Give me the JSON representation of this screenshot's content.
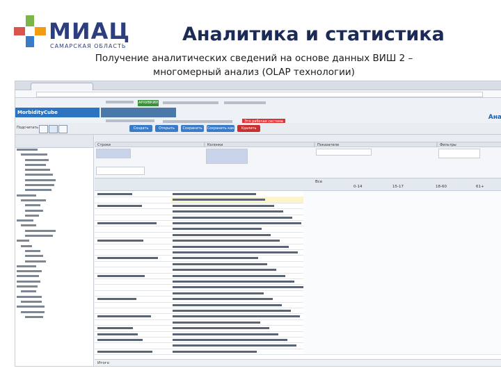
{
  "header": {
    "logo_text": "МИАЦ",
    "logo_subtitle": "САМАРСКАЯ ОБЛАСТЬ",
    "title": "Аналитика и статистика",
    "subtitle_line1": "Получение аналитических сведений на основе данных ВИШ 2 –",
    "subtitle_line2": "многомерный анализ (OLAP технологии)"
  },
  "colors": {
    "logo_blue": "#2c3e7d",
    "cross_green": "#7ab648",
    "cross_orange": "#f39c12",
    "cross_blue": "#3a7bc8",
    "cross_red": "#d9534f"
  },
  "screenshot": {
    "brand": "MorbidityCube",
    "status_green": "АРХИВКИИ",
    "status_red": "Это рабочая система",
    "toolbar_label": "Подсчитать",
    "toolbar_buttons": [
      "Создать",
      "Открыть",
      "Сохранить",
      "Сохранить как",
      "Удалить"
    ],
    "toolbar_right": "Ана",
    "panels": [
      "Строки",
      "Колонки",
      "Показатели",
      "Фильтры"
    ],
    "total_label": "Все",
    "columns": [
      "0-14",
      "15-17",
      "18-60",
      "61+"
    ],
    "footer": "Итого"
  }
}
